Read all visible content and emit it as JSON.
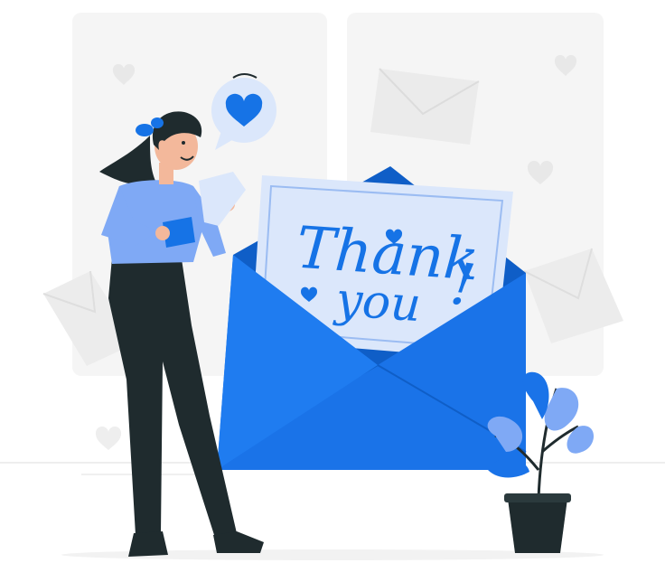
{
  "illustration": {
    "card_text": {
      "line1": "Thank",
      "line2": "you",
      "punct": "!"
    },
    "colors": {
      "accent": "#1673e6",
      "accent_dark": "#0f5ec7",
      "light_blue": "#7fa9f5",
      "pale_blue": "#c9dbfb",
      "panel_gray": "#f4f4f4",
      "deco_gray": "#e6e6e6",
      "dark": "#1f2b2e",
      "skin": "#f3b89b"
    },
    "icons": [
      "heart-bubble-icon",
      "envelope-icon",
      "heart-icon",
      "plant-icon"
    ]
  }
}
